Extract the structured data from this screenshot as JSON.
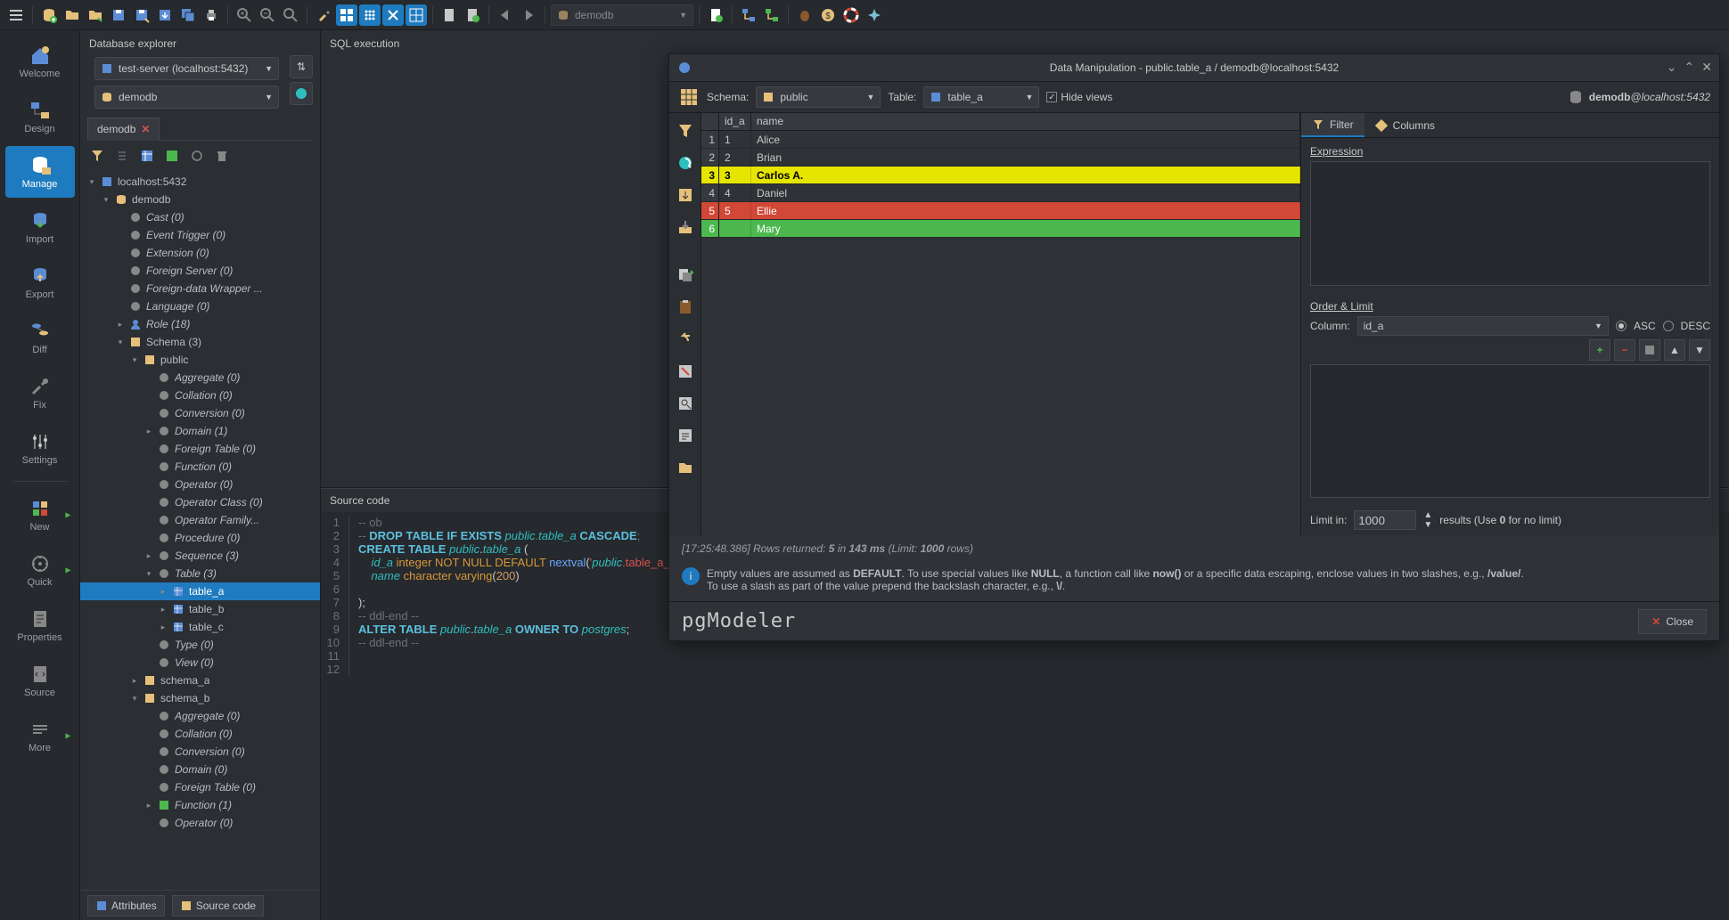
{
  "toolbar_db_label": "demodb",
  "sidebar": {
    "items": [
      {
        "label": "Welcome"
      },
      {
        "label": "Design"
      },
      {
        "label": "Manage"
      },
      {
        "label": "Import"
      },
      {
        "label": "Export"
      },
      {
        "label": "Diff"
      },
      {
        "label": "Fix"
      },
      {
        "label": "Settings"
      },
      {
        "label": "New"
      },
      {
        "label": "Quick"
      },
      {
        "label": "Properties"
      },
      {
        "label": "Source"
      },
      {
        "label": "More"
      }
    ]
  },
  "explorer": {
    "title": "Database explorer",
    "connection": "test-server (localhost:5432)",
    "database": "demodb",
    "tab_name": "demodb",
    "host": "localhost:5432",
    "db": "demodb",
    "nodes": [
      {
        "label": "Cast (0)"
      },
      {
        "label": "Event Trigger (0)"
      },
      {
        "label": "Extension (0)"
      },
      {
        "label": "Foreign Server (0)"
      },
      {
        "label": "Foreign-data Wrapper ..."
      },
      {
        "label": "Language (0)"
      },
      {
        "label": "Role (18)"
      },
      {
        "label": "Schema (3)"
      }
    ],
    "public_children": [
      {
        "label": "Aggregate (0)"
      },
      {
        "label": "Collation (0)"
      },
      {
        "label": "Conversion (0)"
      },
      {
        "label": "Domain (1)"
      },
      {
        "label": "Foreign Table (0)"
      },
      {
        "label": "Function (0)"
      },
      {
        "label": "Operator (0)"
      },
      {
        "label": "Operator Class (0)"
      },
      {
        "label": "Operator Family..."
      },
      {
        "label": "Procedure (0)"
      },
      {
        "label": "Sequence (3)"
      },
      {
        "label": "Table (3)"
      }
    ],
    "tables": [
      "table_a",
      "table_b",
      "table_c"
    ],
    "after_tables": [
      {
        "label": "Type (0)"
      },
      {
        "label": "View (0)"
      }
    ],
    "other_schemas": [
      "schema_a",
      "schema_b"
    ],
    "schema_b_children": [
      {
        "label": "Aggregate (0)"
      },
      {
        "label": "Collation (0)"
      },
      {
        "label": "Conversion (0)"
      },
      {
        "label": "Domain (0)"
      },
      {
        "label": "Foreign Table (0)"
      },
      {
        "label": "Function (1)"
      },
      {
        "label": "Operator (0)"
      }
    ],
    "public_label": "public",
    "footer_attrs": "Attributes",
    "footer_source": "Source code"
  },
  "sql_exec_label": "SQL execution",
  "source_code_label": "Source code",
  "code_lines": [
    "-- ob",
    "-- DROP TABLE IF EXISTS public.table_a CASCADE;",
    "CREATE TABLE public.table_a (",
    "    id_a integer NOT NULL DEFAULT nextval('public.table_a_id_a_seq'::regclass),",
    "    name character varying(200)",
    "",
    ");",
    "-- ddl-end --",
    "ALTER TABLE public.table_a OWNER TO postgres;",
    "-- ddl-end --",
    "",
    ""
  ],
  "dialog": {
    "title": "Data Manipulation - public.table_a / demodb@localhost:5432",
    "schema_label": "Schema:",
    "schema_value": "public",
    "table_label": "Table:",
    "table_value": "table_a",
    "hide_views": "Hide views",
    "conn_label": "demodb@localhost:5432",
    "conn_prefix": "demodb",
    "columns": [
      "id_a",
      "name"
    ],
    "rows": [
      {
        "n": 1,
        "id": "1",
        "name": "Alice",
        "cls": ""
      },
      {
        "n": 2,
        "id": "2",
        "name": "Brian",
        "cls": ""
      },
      {
        "n": 3,
        "id": "3",
        "name": "Carlos A.",
        "cls": "yellow"
      },
      {
        "n": 4,
        "id": "4",
        "name": "Daniel",
        "cls": ""
      },
      {
        "n": 5,
        "id": "5",
        "name": "Ellie",
        "cls": "red"
      },
      {
        "n": 6,
        "id": "",
        "name": "Mary",
        "cls": "green"
      }
    ],
    "filter_tab": "Filter",
    "columns_tab": "Columns",
    "expression_label": "Expression",
    "order_label": "Order & Limit",
    "column_label": "Column:",
    "column_value": "id_a",
    "asc": "ASC",
    "desc": "DESC",
    "limit_label": "Limit in:",
    "limit_value": "1000",
    "limit_hint": "results (Use 0 for no limit)",
    "status_time": "[17:25:48.386]",
    "status_text1": "Rows returned:",
    "status_n": "5",
    "status_in": "in",
    "status_ms": "143 ms",
    "status_limit": "(Limit:",
    "status_limit_n": "1000",
    "status_rows": "rows)",
    "hint1": "Empty values are assumed as DEFAULT. To use special values like NULL, a function call like now() or a specific data escaping, enclose values in two slashes, e.g., /value/.",
    "hint2": "To use a slash as part of the value prepend the backslash character, e.g., V.",
    "brand": "pgModeler",
    "close": "Close"
  }
}
